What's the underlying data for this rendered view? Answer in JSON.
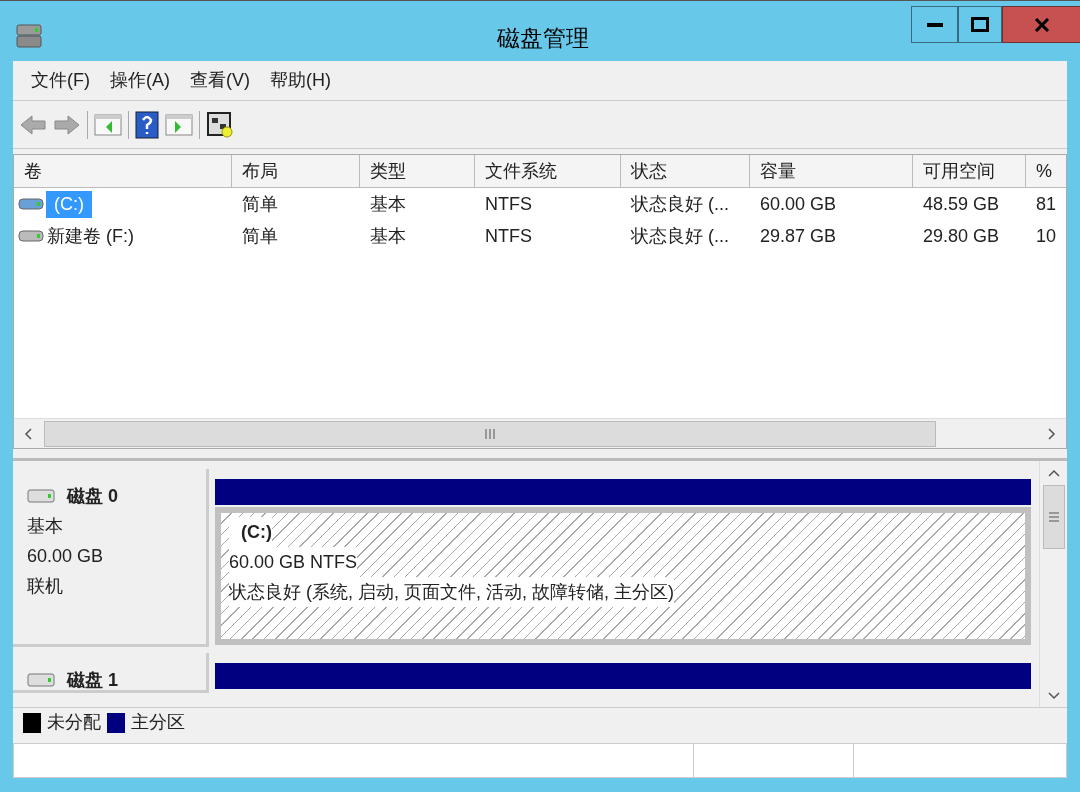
{
  "window": {
    "title": "磁盘管理"
  },
  "menu": [
    "文件(F)",
    "操作(A)",
    "查看(V)",
    "帮助(H)"
  ],
  "table": {
    "columns": [
      "卷",
      "布局",
      "类型",
      "文件系统",
      "状态",
      "容量",
      "可用空间",
      "%"
    ],
    "rows": [
      {
        "selected": true,
        "cells": [
          "(C:)",
          "简单",
          "基本",
          "NTFS",
          "状态良好 (...",
          "60.00 GB",
          "48.59 GB",
          "81"
        ]
      },
      {
        "selected": false,
        "cells": [
          "新建卷 (F:)",
          "简单",
          "基本",
          "NTFS",
          "状态良好 (...",
          "29.87 GB",
          "29.80 GB",
          "10"
        ]
      }
    ]
  },
  "disks": [
    {
      "name": "磁盘 0",
      "type": "基本",
      "size": "60.00 GB",
      "status": "联机",
      "partitions": [
        {
          "label": "(C:)",
          "size": "60.00 GB NTFS",
          "status": "状态良好 (系统, 启动, 页面文件, 活动, 故障转储, 主分区)"
        }
      ]
    },
    {
      "name": "磁盘 1"
    }
  ],
  "legend": [
    {
      "label": "未分配",
      "color": "#000000"
    },
    {
      "label": "主分区",
      "color": "#000080"
    }
  ]
}
